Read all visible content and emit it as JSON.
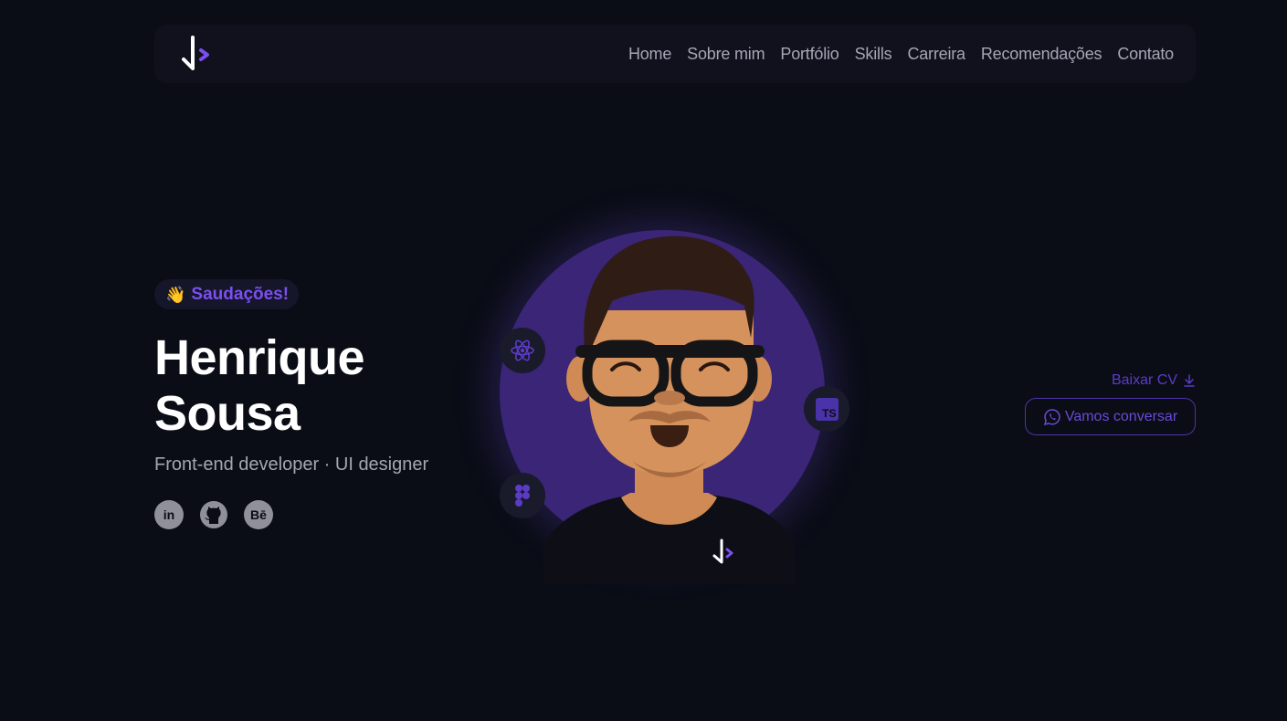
{
  "nav": {
    "links": [
      "Home",
      "Sobre mim",
      "Portfólio",
      "Skills",
      "Carreira",
      "Recomendações",
      "Contato"
    ]
  },
  "hero": {
    "greeting": "Saudações!",
    "greeting_emoji": "👋",
    "name": "Henrique Sousa",
    "subtitle": "Front-end developer · UI designer"
  },
  "socials": [
    {
      "icon": "linkedin-icon",
      "label": "in"
    },
    {
      "icon": "github-icon",
      "label": ""
    },
    {
      "icon": "behance-icon",
      "label": "Bē"
    }
  ],
  "tech_icons": [
    "react-icon",
    "typescript-icon",
    "figma-icon"
  ],
  "typescript_label": "TS",
  "actions": {
    "download_cv": "Baixar CV",
    "chat": "Vamos conversar"
  },
  "colors": {
    "accent": "#7b4ff0",
    "background": "#0a0d16",
    "navbar": "#11111e",
    "avatar_circle": "#3a2576"
  }
}
